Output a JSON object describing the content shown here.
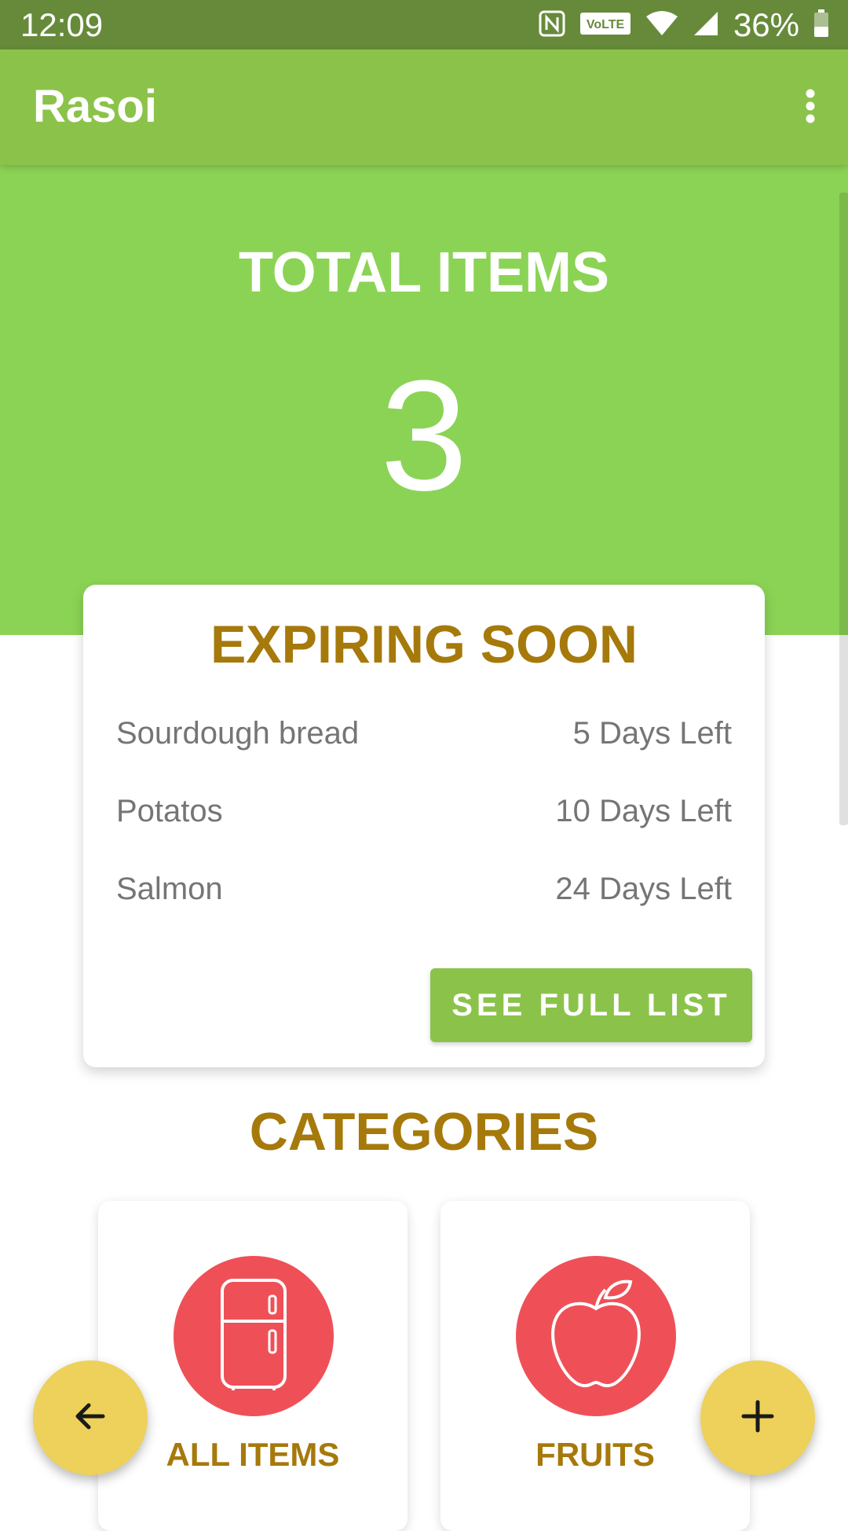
{
  "status_bar": {
    "time": "12:09",
    "volte_badge": "VoLTE",
    "battery_percent": "36%",
    "icons": [
      "nfc-icon",
      "volte-icon",
      "wifi-icon",
      "cell-signal-icon",
      "battery-icon"
    ]
  },
  "app_bar": {
    "title": "Rasoi",
    "menu_icon": "more-vert-icon"
  },
  "summary": {
    "label": "TOTAL ITEMS",
    "count": "3"
  },
  "expiring": {
    "title": "EXPIRING SOON",
    "items": [
      {
        "name": "Sourdough bread",
        "days_left": "5 Days Left"
      },
      {
        "name": "Potatos",
        "days_left": "10 Days Left"
      },
      {
        "name": "Salmon",
        "days_left": "24 Days Left"
      }
    ],
    "button_label": "SEE FULL LIST"
  },
  "categories": {
    "title": "CATEGORIES",
    "items": [
      {
        "label": "ALL ITEMS",
        "icon": "fridge-icon"
      },
      {
        "label": "FRUITS",
        "icon": "apple-icon"
      }
    ]
  },
  "fabs": {
    "back_icon": "arrow-back-icon",
    "add_icon": "plus-icon"
  },
  "colors": {
    "status_bar": "#668A3A",
    "app_bar": "#8BC34A",
    "hero": "#8BD355",
    "accent_text": "#A6790B",
    "category_circle": "#EF5057",
    "fab": "#EDD15A"
  }
}
